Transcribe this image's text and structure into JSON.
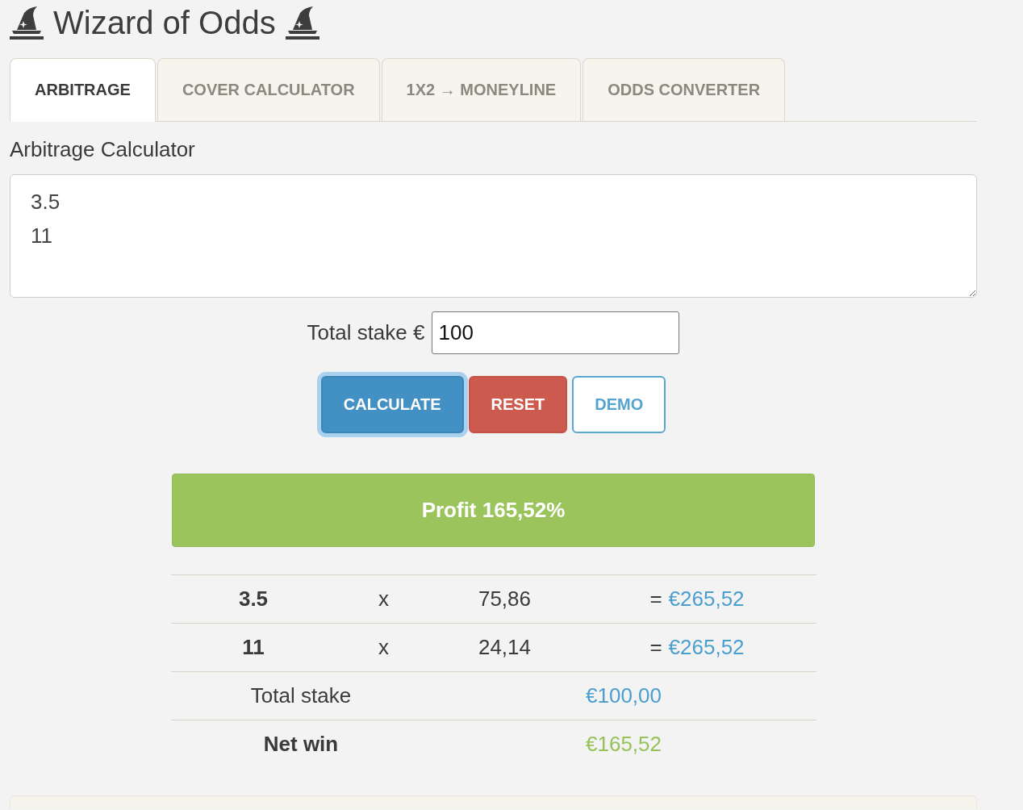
{
  "header": {
    "title": "Wizard of Odds"
  },
  "tabs": [
    {
      "label": "ARBITRAGE",
      "selected": true
    },
    {
      "label": "COVER CALCULATOR",
      "selected": false
    },
    {
      "label": "1X2 → MONEYLINE",
      "selected": false
    },
    {
      "label": "ODDS CONVERTER",
      "selected": false
    }
  ],
  "calculator": {
    "heading": "Arbitrage Calculator",
    "odds_field": {
      "value": "3.5\n11"
    },
    "stake_field": {
      "label": "Total stake €",
      "value": "100"
    },
    "buttons": [
      {
        "label": "CALCULATE",
        "kind": "primary",
        "focused": true
      },
      {
        "label": "RESET",
        "kind": "danger",
        "focused": false
      },
      {
        "label": "DEMO",
        "kind": "outline",
        "focused": false
      }
    ]
  },
  "result": {
    "profit": "Profit 165,52%",
    "bets": [
      {
        "odds": "3.5",
        "operator": "x",
        "stake": "75,86",
        "equals": "=",
        "payout": "€265,52"
      },
      {
        "odds": "11",
        "operator": "x",
        "stake": "24,14",
        "equals": "=",
        "payout": "€265,52"
      }
    ],
    "summary": [
      {
        "kind": "total",
        "label": "Total stake",
        "value": "€100,00"
      },
      {
        "kind": "net",
        "label": "Net win",
        "value": "€165,52"
      }
    ]
  }
}
